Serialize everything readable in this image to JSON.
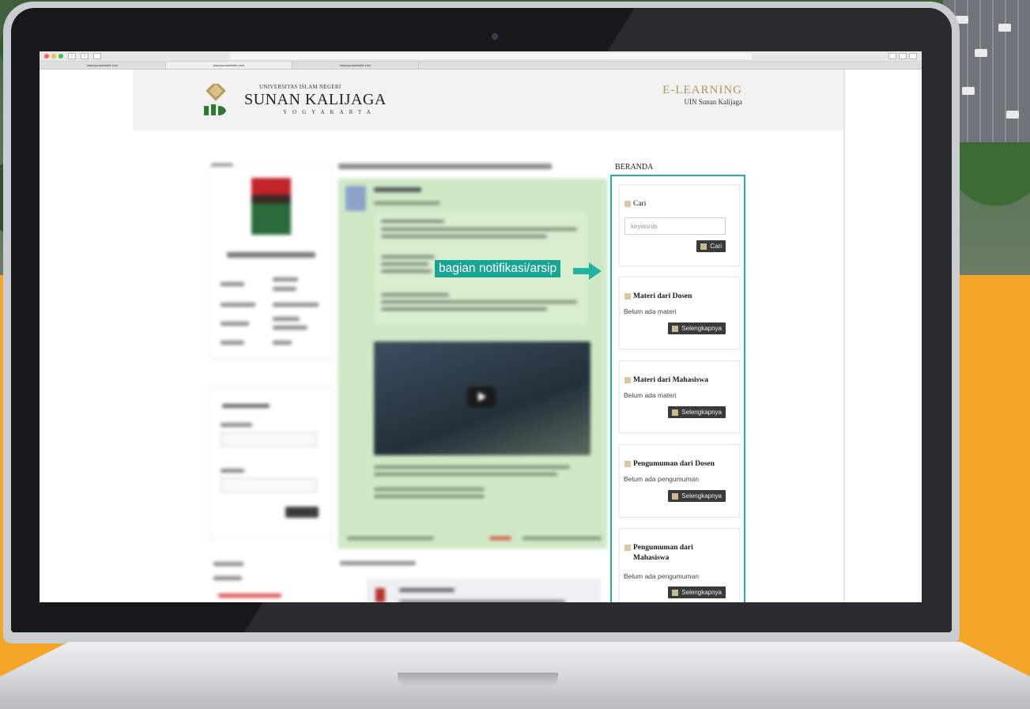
{
  "browser": {
    "tabs": [
      "www.yourwebsite.com",
      "www.yourwebsite.com",
      "www.yourwebsite.com"
    ]
  },
  "site": {
    "university_prefix": "UNIVERSITAS ISLAM NEGERI",
    "university_name": "SUNAN KALIJAGA",
    "city": "YOGYAKARTA",
    "elearning_title": "E-LEARNING",
    "elearning_subtitle": "UIN Sunan Kalijaga"
  },
  "annotation": {
    "label": "bagian notifikasi/arsip",
    "color": "#19a593"
  },
  "beranda": {
    "title": "BERANDA",
    "search": {
      "title": "Cari",
      "placeholder": "keywords",
      "button": "Cari"
    },
    "widgets": [
      {
        "title": "Materi dari Dosen",
        "status": "Belum ada materi",
        "button": "Selengkapnya"
      },
      {
        "title": "Materi dari Mahasiswa",
        "status": "Belum ada materi",
        "button": "Selengkapnya"
      },
      {
        "title": "Pengumuman dari Dosen",
        "status": "Belum ada pengumuman",
        "button": "Selengkapnya"
      },
      {
        "title": "Pengumuman dari Mahasiswa",
        "status": "Belum ada pengumuman",
        "button": "Selengkapnya"
      }
    ]
  },
  "colors": {
    "accent": "#22b3a2",
    "background": "#f2a526",
    "post_highlight": "#cfe9c5"
  }
}
